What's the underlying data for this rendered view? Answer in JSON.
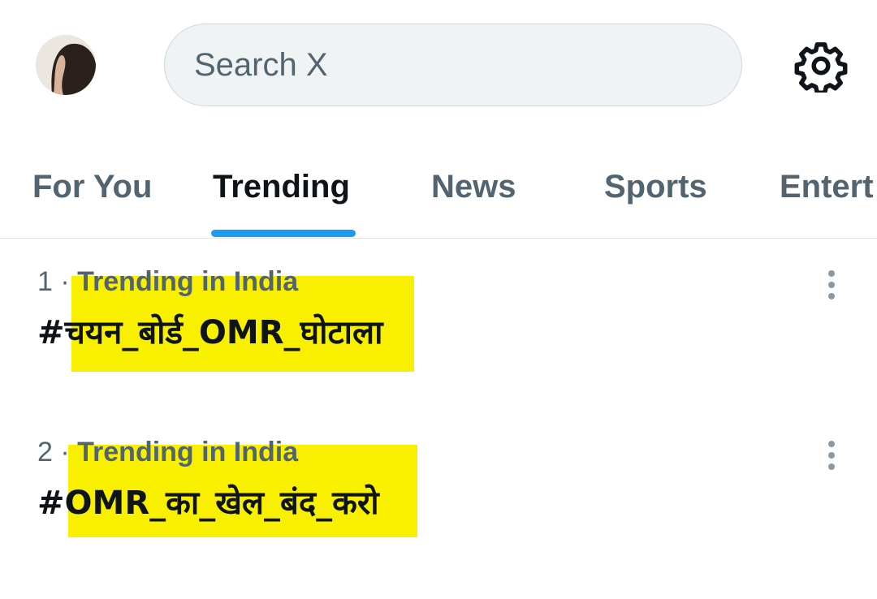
{
  "header": {
    "search_placeholder": "Search X",
    "avatar_icon": "avatar",
    "settings_icon": "gear-icon"
  },
  "tabs": [
    {
      "label": "For You",
      "active": false
    },
    {
      "label": "Trending",
      "active": true
    },
    {
      "label": "News",
      "active": false
    },
    {
      "label": "Sports",
      "active": false
    },
    {
      "label": "Entert",
      "active": false
    }
  ],
  "trends": [
    {
      "rank": "1",
      "separator": " · ",
      "context": "Trending in India",
      "name": "#चयन_बोर्ड_OMR_घोटाला",
      "more_icon": "more-vertical-icon"
    },
    {
      "rank": "2",
      "separator": " · ",
      "context": "Trending in India",
      "name": "#OMR_का_खेल_बंद_करो",
      "more_icon": "more-vertical-icon"
    }
  ],
  "colors": {
    "accent": "#1d9bf0",
    "highlight": "#f8f000",
    "text_primary": "#0f1419",
    "text_secondary": "#536471"
  }
}
